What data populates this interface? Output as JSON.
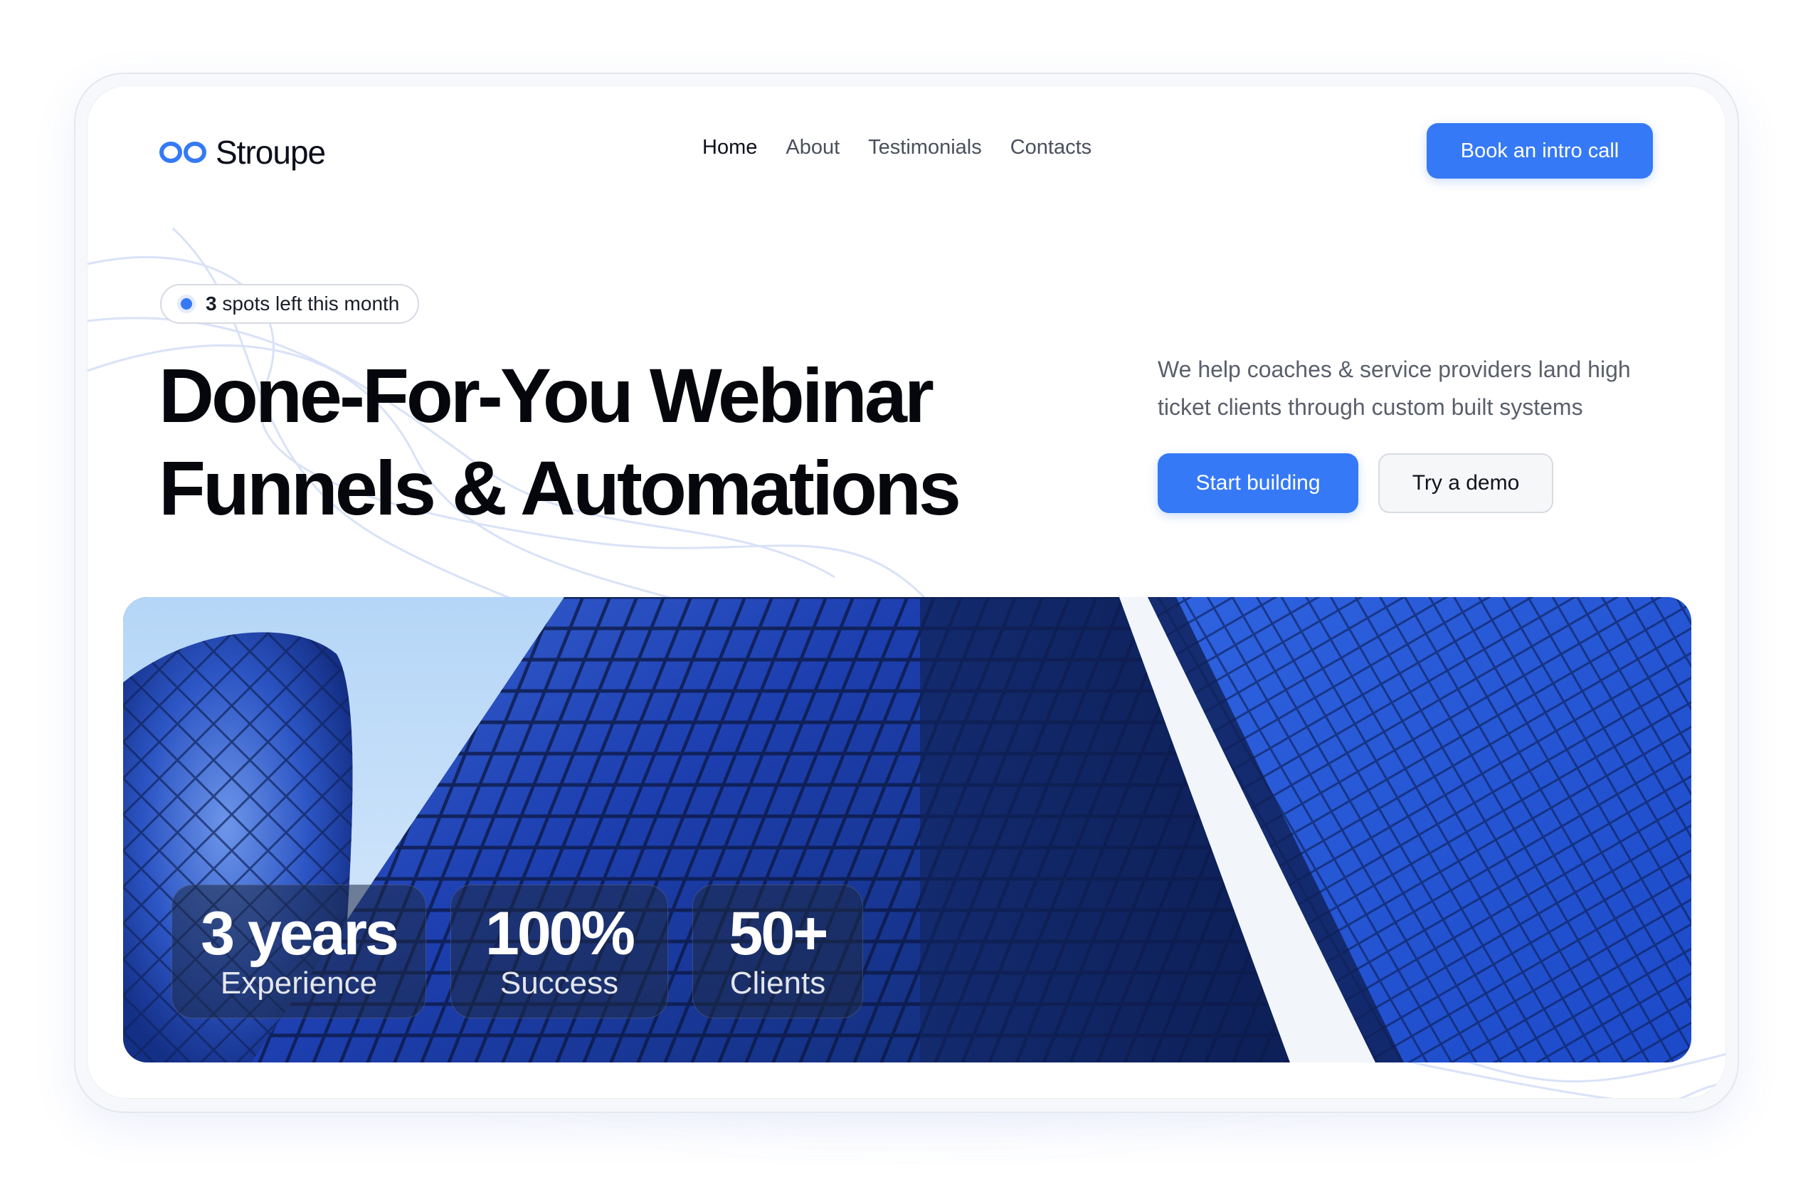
{
  "brand": {
    "name": "Stroupe",
    "logo_icon": "infinity-loop-icon",
    "accent": "#3579f6"
  },
  "nav": {
    "items": [
      {
        "label": "Home",
        "active": true
      },
      {
        "label": "About",
        "active": false
      },
      {
        "label": "Testimonials",
        "active": false
      },
      {
        "label": "Contacts",
        "active": false
      }
    ]
  },
  "header": {
    "cta_label": "Book an intro call"
  },
  "hero": {
    "badge": {
      "count": "3",
      "text": " spots left this month"
    },
    "title_line1": "Done-For-You Webinar",
    "title_line2": "Funnels & Automations",
    "subtitle": "We help coaches & service providers land high ticket clients through custom built systems",
    "primary_cta": "Start building",
    "secondary_cta": "Try a demo"
  },
  "stats": [
    {
      "value": "3 years",
      "label": "Experience"
    },
    {
      "value": "100%",
      "label": "Success"
    },
    {
      "value": "50+",
      "label": "Clients"
    }
  ]
}
